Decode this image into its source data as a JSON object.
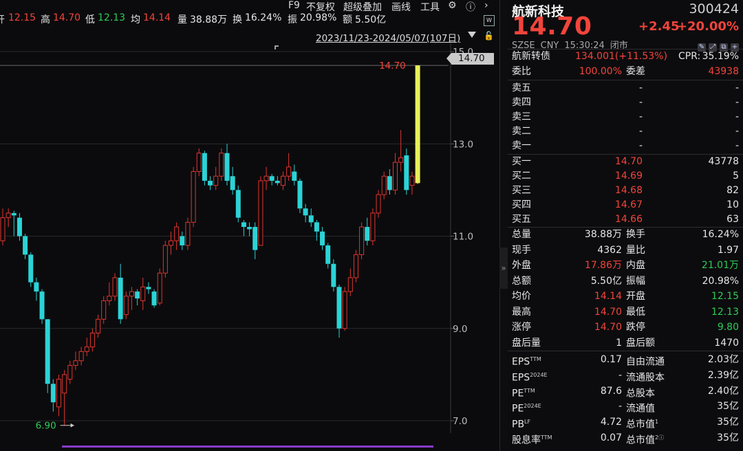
{
  "quote_strip": {
    "open_label": "开",
    "open": "12.15",
    "high_label": "高",
    "high": "14.70",
    "low_label": "低",
    "low": "12.13",
    "avg_label": "均",
    "avg": "14.14",
    "volume_label": "量",
    "volume": "38.88万",
    "turnover_label": "换",
    "turnover": "16.24%",
    "amplitude_label": "振",
    "amplitude": "20.98%",
    "amount_label": "额",
    "amount": "5.50亿"
  },
  "toolbar": {
    "f9": "F9",
    "no_adjust": "不复权",
    "overlay": "超级叠加",
    "draw": "画线",
    "tools": "工具",
    "settings_icon": "gear-icon",
    "help_icon": "help-icon",
    "next_icon": "chevron-right-icon"
  },
  "range": {
    "text": "2023/11/23-2024/05/07(107日)"
  },
  "chart_data": {
    "type": "candlestick",
    "y_ticks": [
      "15.0",
      "13.0",
      "11.0",
      "9.0",
      "7.0"
    ],
    "ylim": [
      7.0,
      15.0
    ],
    "max_marker": "14.70",
    "min_marker": "6.90",
    "last_price_tag": "14.70",
    "up_color": "#e0362f",
    "down_color": "#2bd3d6",
    "limit_up_color": "#e8f05a",
    "candles": [
      {
        "o": 10.9,
        "h": 11.6,
        "l": 10.8,
        "c": 11.4
      },
      {
        "o": 11.4,
        "h": 11.6,
        "l": 11.2,
        "c": 11.5
      },
      {
        "o": 11.5,
        "h": 11.55,
        "l": 11.0,
        "c": 11.45
      },
      {
        "o": 11.4,
        "h": 11.5,
        "l": 10.9,
        "c": 11.0
      },
      {
        "o": 11.0,
        "h": 11.05,
        "l": 10.5,
        "c": 10.6
      },
      {
        "o": 10.6,
        "h": 10.65,
        "l": 9.9,
        "c": 10.0
      },
      {
        "o": 10.0,
        "h": 10.1,
        "l": 9.6,
        "c": 9.8
      },
      {
        "o": 9.8,
        "h": 9.85,
        "l": 9.1,
        "c": 9.2
      },
      {
        "o": 9.2,
        "h": 9.2,
        "l": 7.6,
        "c": 7.8
      },
      {
        "o": 7.8,
        "h": 7.9,
        "l": 7.2,
        "c": 7.4
      },
      {
        "o": 7.3,
        "h": 8.0,
        "l": 7.1,
        "c": 7.9
      },
      {
        "o": 7.6,
        "h": 8.1,
        "l": 6.9,
        "c": 8.0
      },
      {
        "o": 7.9,
        "h": 8.3,
        "l": 7.8,
        "c": 8.2
      },
      {
        "o": 8.2,
        "h": 8.5,
        "l": 8.1,
        "c": 8.3
      },
      {
        "o": 8.3,
        "h": 8.6,
        "l": 8.2,
        "c": 8.5
      },
      {
        "o": 8.5,
        "h": 8.8,
        "l": 8.4,
        "c": 8.6
      },
      {
        "o": 8.6,
        "h": 9.0,
        "l": 8.5,
        "c": 8.9
      },
      {
        "o": 8.9,
        "h": 9.3,
        "l": 8.8,
        "c": 9.2
      },
      {
        "o": 9.2,
        "h": 9.7,
        "l": 9.1,
        "c": 9.6
      },
      {
        "o": 9.6,
        "h": 10.0,
        "l": 9.5,
        "c": 9.7
      },
      {
        "o": 9.7,
        "h": 10.2,
        "l": 9.6,
        "c": 10.1
      },
      {
        "o": 10.1,
        "h": 10.4,
        "l": 9.1,
        "c": 9.2
      },
      {
        "o": 9.3,
        "h": 9.8,
        "l": 9.2,
        "c": 9.7
      },
      {
        "o": 9.7,
        "h": 9.9,
        "l": 9.4,
        "c": 9.8
      },
      {
        "o": 9.8,
        "h": 9.85,
        "l": 9.5,
        "c": 9.65
      },
      {
        "o": 9.6,
        "h": 10.1,
        "l": 9.4,
        "c": 9.9
      },
      {
        "o": 9.9,
        "h": 10.0,
        "l": 9.75,
        "c": 9.85
      },
      {
        "o": 9.8,
        "h": 9.85,
        "l": 9.45,
        "c": 9.5
      },
      {
        "o": 9.55,
        "h": 10.3,
        "l": 9.5,
        "c": 10.2
      },
      {
        "o": 10.2,
        "h": 10.9,
        "l": 10.1,
        "c": 10.8
      },
      {
        "o": 10.8,
        "h": 11.1,
        "l": 10.6,
        "c": 10.9
      },
      {
        "o": 10.9,
        "h": 11.3,
        "l": 10.7,
        "c": 11.2
      },
      {
        "o": 11.0,
        "h": 11.1,
        "l": 10.7,
        "c": 10.8
      },
      {
        "o": 10.8,
        "h": 11.4,
        "l": 10.7,
        "c": 11.3
      },
      {
        "o": 11.3,
        "h": 12.5,
        "l": 11.2,
        "c": 12.4
      },
      {
        "o": 12.4,
        "h": 12.9,
        "l": 12.3,
        "c": 12.8
      },
      {
        "o": 12.8,
        "h": 12.85,
        "l": 12.1,
        "c": 12.2
      },
      {
        "o": 12.2,
        "h": 12.3,
        "l": 12.0,
        "c": 12.1
      },
      {
        "o": 12.1,
        "h": 12.5,
        "l": 12.0,
        "c": 12.3
      },
      {
        "o": 12.3,
        "h": 12.9,
        "l": 12.2,
        "c": 12.8
      },
      {
        "o": 12.8,
        "h": 13.0,
        "l": 12.1,
        "c": 12.2
      },
      {
        "o": 12.3,
        "h": 12.5,
        "l": 11.9,
        "c": 12.0
      },
      {
        "o": 12.0,
        "h": 12.1,
        "l": 11.3,
        "c": 11.4
      },
      {
        "o": 11.3,
        "h": 11.35,
        "l": 11.0,
        "c": 11.2
      },
      {
        "o": 11.2,
        "h": 11.3,
        "l": 11.0,
        "c": 11.15
      },
      {
        "o": 11.2,
        "h": 11.3,
        "l": 10.5,
        "c": 10.7
      },
      {
        "o": 10.8,
        "h": 12.3,
        "l": 10.8,
        "c": 12.2
      },
      {
        "o": 12.2,
        "h": 12.5,
        "l": 12.0,
        "c": 12.3
      },
      {
        "o": 12.3,
        "h": 12.35,
        "l": 12.1,
        "c": 12.2
      },
      {
        "o": 12.2,
        "h": 12.3,
        "l": 12.1,
        "c": 12.15
      },
      {
        "o": 12.1,
        "h": 12.4,
        "l": 12.0,
        "c": 12.3
      },
      {
        "o": 12.3,
        "h": 12.8,
        "l": 12.2,
        "c": 12.5
      },
      {
        "o": 12.4,
        "h": 12.55,
        "l": 12.1,
        "c": 12.2
      },
      {
        "o": 12.2,
        "h": 12.25,
        "l": 11.5,
        "c": 11.6
      },
      {
        "o": 11.6,
        "h": 11.7,
        "l": 11.3,
        "c": 11.45
      },
      {
        "o": 11.45,
        "h": 11.6,
        "l": 11.2,
        "c": 11.3
      },
      {
        "o": 11.3,
        "h": 11.35,
        "l": 10.9,
        "c": 11.1
      },
      {
        "o": 11.1,
        "h": 11.2,
        "l": 10.7,
        "c": 10.8
      },
      {
        "o": 10.8,
        "h": 10.85,
        "l": 10.3,
        "c": 10.4
      },
      {
        "o": 10.4,
        "h": 10.5,
        "l": 9.8,
        "c": 9.9
      },
      {
        "o": 9.9,
        "h": 9.95,
        "l": 8.8,
        "c": 9.0
      },
      {
        "o": 9.0,
        "h": 9.9,
        "l": 8.95,
        "c": 9.8
      },
      {
        "o": 9.8,
        "h": 10.3,
        "l": 9.7,
        "c": 10.1
      },
      {
        "o": 10.1,
        "h": 10.7,
        "l": 10.0,
        "c": 10.6
      },
      {
        "o": 10.6,
        "h": 11.3,
        "l": 10.5,
        "c": 11.2
      },
      {
        "o": 11.2,
        "h": 11.4,
        "l": 10.8,
        "c": 10.9
      },
      {
        "o": 10.9,
        "h": 11.6,
        "l": 10.8,
        "c": 11.5
      },
      {
        "o": 11.5,
        "h": 12.0,
        "l": 11.4,
        "c": 11.9
      },
      {
        "o": 11.9,
        "h": 12.4,
        "l": 11.8,
        "c": 12.3
      },
      {
        "o": 12.3,
        "h": 12.45,
        "l": 11.9,
        "c": 12.0
      },
      {
        "o": 12.0,
        "h": 12.8,
        "l": 11.9,
        "c": 12.6
      },
      {
        "o": 12.6,
        "h": 13.3,
        "l": 12.4,
        "c": 12.7
      },
      {
        "o": 12.75,
        "h": 12.9,
        "l": 11.9,
        "c": 12.0
      },
      {
        "o": 12.1,
        "h": 12.4,
        "l": 11.9,
        "c": 12.3
      },
      {
        "o": 12.15,
        "h": 14.7,
        "l": 12.13,
        "c": 14.7,
        "limit": true
      }
    ]
  },
  "panel": {
    "name": "航新科技",
    "code": "300424",
    "price": "14.70",
    "change": "+2.45",
    "change_pct": "+20.00%",
    "exchange": "SZSE",
    "currency": "CNY",
    "time": "15:30:24",
    "status": "闭市",
    "bond_label": "航新转债",
    "bond_value": "134.001(+11.53%)",
    "cpr_label": "CPR:",
    "cpr_value": "35.19%",
    "weibi_label": "委比",
    "weibi_value": "100.00%",
    "weicha_label": "委差",
    "weicha_value": "43938",
    "asks": [
      {
        "label": "卖五",
        "price": "-",
        "vol": "-"
      },
      {
        "label": "卖四",
        "price": "-",
        "vol": "-"
      },
      {
        "label": "卖三",
        "price": "-",
        "vol": "-"
      },
      {
        "label": "卖二",
        "price": "-",
        "vol": "-"
      },
      {
        "label": "卖一",
        "price": "-",
        "vol": "-"
      }
    ],
    "bids": [
      {
        "label": "买一",
        "price": "14.70",
        "vol": "43778"
      },
      {
        "label": "买二",
        "price": "14.69",
        "vol": "5"
      },
      {
        "label": "买三",
        "price": "14.68",
        "vol": "82"
      },
      {
        "label": "买四",
        "price": "14.67",
        "vol": "10"
      },
      {
        "label": "买五",
        "price": "14.66",
        "vol": "63"
      }
    ],
    "stats": [
      {
        "l1": "总量",
        "v1": "38.88万",
        "c1": "white",
        "l2": "换手",
        "v2": "16.24%",
        "c2": "white"
      },
      {
        "l1": "现手",
        "v1": "4362",
        "c1": "white",
        "l2": "量比",
        "v2": "1.97",
        "c2": "white"
      },
      {
        "l1": "外盘",
        "v1": "17.86万",
        "c1": "red",
        "l2": "内盘",
        "v2": "21.01万",
        "c2": "green"
      },
      {
        "l1": "总额",
        "v1": "5.50亿",
        "c1": "white",
        "l2": "振幅",
        "v2": "20.98%",
        "c2": "white"
      },
      {
        "l1": "均价",
        "v1": "14.14",
        "c1": "red",
        "l2": "开盘",
        "v2": "12.15",
        "c2": "green"
      },
      {
        "l1": "最高",
        "v1": "14.70",
        "c1": "red",
        "l2": "最低",
        "v2": "12.13",
        "c2": "green"
      },
      {
        "l1": "涨停",
        "v1": "14.70",
        "c1": "red",
        "l2": "跌停",
        "v2": "9.80",
        "c2": "green"
      },
      {
        "l1": "盘后量",
        "v1": "1",
        "c1": "white",
        "l2": "盘后额",
        "v2": "1470",
        "c2": "white"
      }
    ],
    "fundamentals": [
      {
        "l1": "EPS",
        "s1": "TTM",
        "v1": "0.17",
        "l2": "自由流通",
        "s2": "",
        "v2": "2.03亿"
      },
      {
        "l1": "EPS",
        "s1": "2024E",
        "v1": "-",
        "l2": "流通股本",
        "s2": "",
        "v2": "2.39亿"
      },
      {
        "l1": "PE",
        "s1": "TTM",
        "v1": "87.6",
        "l2": "总股本",
        "s2": "",
        "v2": "2.40亿"
      },
      {
        "l1": "PE",
        "s1": "2024E",
        "v1": "-",
        "l2": "流通值",
        "s2": "",
        "v2": "35亿"
      },
      {
        "l1": "PB",
        "s1": "LF",
        "v1": "4.72",
        "l2": "总市值",
        "s2": "1",
        "v2": "35亿"
      },
      {
        "l1": "股息率",
        "s1": "TTM",
        "v1": "0.07",
        "l2": "总市值",
        "s2": "2ⓘ",
        "v2": "35亿"
      }
    ],
    "collapse_icon": "double-chevron-right-icon"
  }
}
